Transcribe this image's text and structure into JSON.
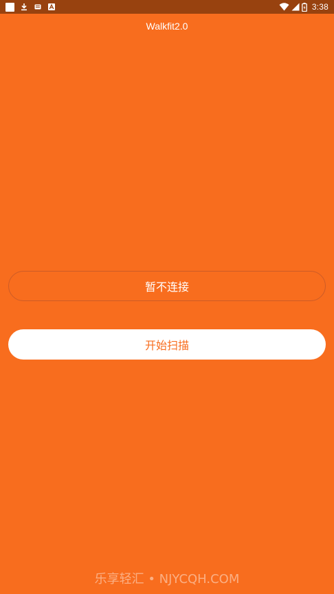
{
  "status_bar": {
    "time": "3:38",
    "left_icons": [
      "notification-square-icon",
      "download-icon",
      "app-icon",
      "a-icon"
    ],
    "right_icons": [
      "wifi-icon",
      "signal-icon",
      "battery-icon"
    ]
  },
  "header": {
    "title": "Walkfit2.0"
  },
  "actions": {
    "disconnect_label": "暂不连接",
    "scan_label": "开始扫描"
  },
  "watermark": {
    "text": "乐享轻汇 • NJYCQH.COM"
  },
  "colors": {
    "background": "#f86d1e",
    "status_bar": "#98420f",
    "primary_text": "#ffffff",
    "button_fill": "#ffffff",
    "button_text": "#f86d1e"
  }
}
